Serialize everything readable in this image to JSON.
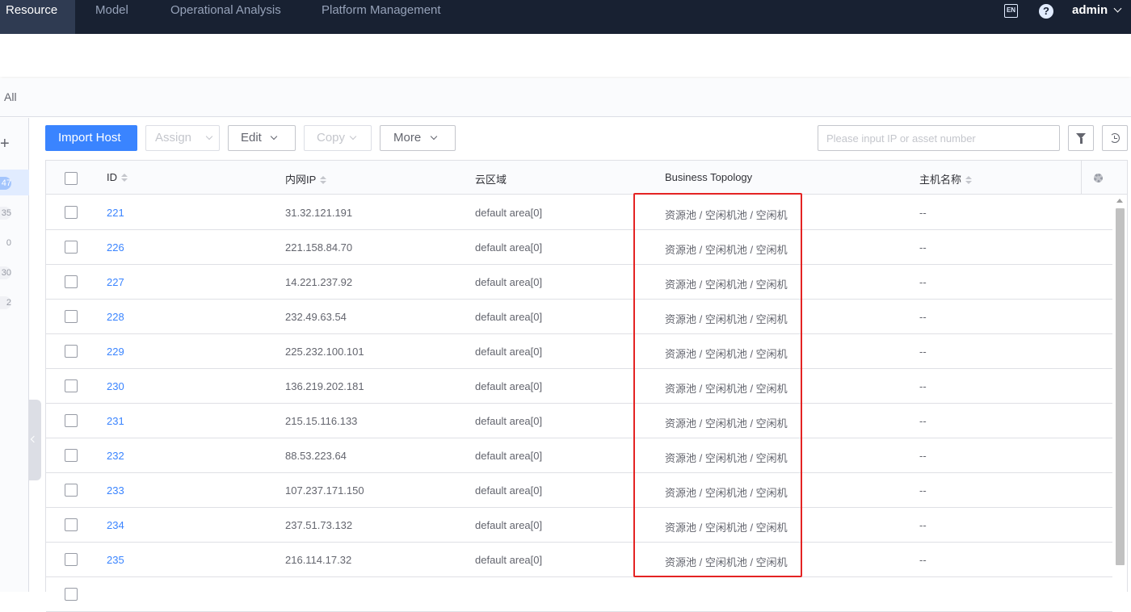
{
  "nav": {
    "items": [
      "Resource",
      "Model",
      "Operational Analysis",
      "Platform Management"
    ],
    "active_index": 0,
    "lang_icon_label": "EN",
    "help_icon_label": "?",
    "user": "admin"
  },
  "breadcrumb": {
    "label": "All"
  },
  "sidebar": {
    "plus_label": "+",
    "counts": [
      "47",
      "35",
      "0",
      "30",
      "2"
    ],
    "active_index": 0
  },
  "toolbar": {
    "import_label": "Import Host",
    "assign_label": "Assign",
    "edit_label": "Edit",
    "copy_label": "Copy",
    "more_label": "More",
    "search_placeholder": "Please input IP or asset number"
  },
  "table": {
    "columns": [
      "ID",
      "内网IP",
      "云区域",
      "Business Topology",
      "主机名称"
    ],
    "rows": [
      {
        "id": "221",
        "ip": "31.32.121.191",
        "area": "default area[0]",
        "topo": "资源池 / 空闲机池 / 空闲机",
        "host": "--"
      },
      {
        "id": "226",
        "ip": "221.158.84.70",
        "area": "default area[0]",
        "topo": "资源池 / 空闲机池 / 空闲机",
        "host": "--"
      },
      {
        "id": "227",
        "ip": "14.221.237.92",
        "area": "default area[0]",
        "topo": "资源池 / 空闲机池 / 空闲机",
        "host": "--"
      },
      {
        "id": "228",
        "ip": "232.49.63.54",
        "area": "default area[0]",
        "topo": "资源池 / 空闲机池 / 空闲机",
        "host": "--"
      },
      {
        "id": "229",
        "ip": "225.232.100.101",
        "area": "default area[0]",
        "topo": "资源池 / 空闲机池 / 空闲机",
        "host": "--"
      },
      {
        "id": "230",
        "ip": "136.219.202.181",
        "area": "default area[0]",
        "topo": "资源池 / 空闲机池 / 空闲机",
        "host": "--"
      },
      {
        "id": "231",
        "ip": "215.15.116.133",
        "area": "default area[0]",
        "topo": "资源池 / 空闲机池 / 空闲机",
        "host": "--"
      },
      {
        "id": "232",
        "ip": "88.53.223.64",
        "area": "default area[0]",
        "topo": "资源池 / 空闲机池 / 空闲机",
        "host": "--"
      },
      {
        "id": "233",
        "ip": "107.237.171.150",
        "area": "default area[0]",
        "topo": "资源池 / 空闲机池 / 空闲机",
        "host": "--"
      },
      {
        "id": "234",
        "ip": "237.51.73.132",
        "area": "default area[0]",
        "topo": "资源池 / 空闲机池 / 空闲机",
        "host": "--"
      },
      {
        "id": "235",
        "ip": "216.114.17.32",
        "area": "default area[0]",
        "topo": "资源池 / 空闲机池 / 空闲机",
        "host": "--"
      }
    ]
  },
  "colors": {
    "nav_bg": "#182132",
    "primary": "#3a84ff",
    "highlight": "#e42323"
  }
}
